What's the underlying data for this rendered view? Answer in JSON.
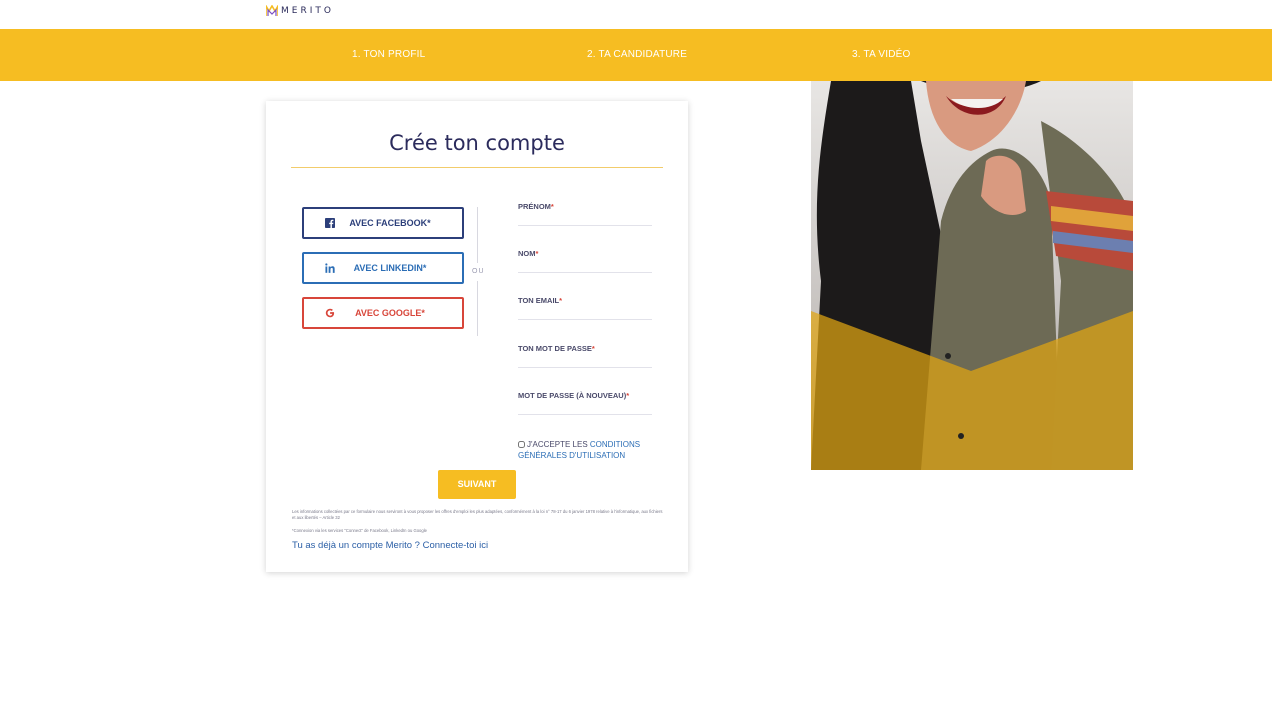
{
  "brand": {
    "name": "MERITO",
    "accent": "#f6bd22",
    "navy": "#2a2a5a"
  },
  "steps": [
    {
      "label": "1. TON PROFIL"
    },
    {
      "label": "2. TA CANDIDATURE"
    },
    {
      "label": "3. TA VIDÉO"
    }
  ],
  "form": {
    "title": "Crée ton compte",
    "social": {
      "facebook": {
        "label": "AVEC FACEBOOK*",
        "icon": "facebook-icon"
      },
      "linkedin": {
        "label": "AVEC LINKEDIN*",
        "icon": "linkedin-icon"
      },
      "google": {
        "label": "AVEC GOOGLE*",
        "icon": "google-icon"
      }
    },
    "separator": "OU",
    "fields": {
      "firstname": {
        "label": "PRÉNOM",
        "required": "*",
        "value": ""
      },
      "lastname": {
        "label": "NOM",
        "required": "*",
        "value": ""
      },
      "email": {
        "label": "TON EMAIL",
        "required": "*",
        "value": ""
      },
      "password": {
        "label": "TON MOT DE PASSE",
        "required": "*",
        "value": ""
      },
      "password_confirm": {
        "label": "MOT DE PASSE (À NOUVEAU)",
        "required": "*",
        "value": ""
      }
    },
    "cgu": {
      "prefix": "J'ACCEPTE LES ",
      "link": "CONDITIONS GÉNÉRALES D'UTILISATION",
      "checked": false
    },
    "submit_label": "SUIVANT",
    "legal_text": "Les informations collectées par ce formulaire nous serviront à vous proposer les offres d'emploi les plus adaptées, conformément à la loi n° 78-17 du 6 janvier 1978 relative à l'informatique, aux fichiers et aux libertés – Article 32",
    "legal_note": "*Connexion via les services \"Connect\" de Facebook, LinkedIn ou Google",
    "login_link": "Tu as déjà un compte Merito ? Connecte-toi ici"
  }
}
